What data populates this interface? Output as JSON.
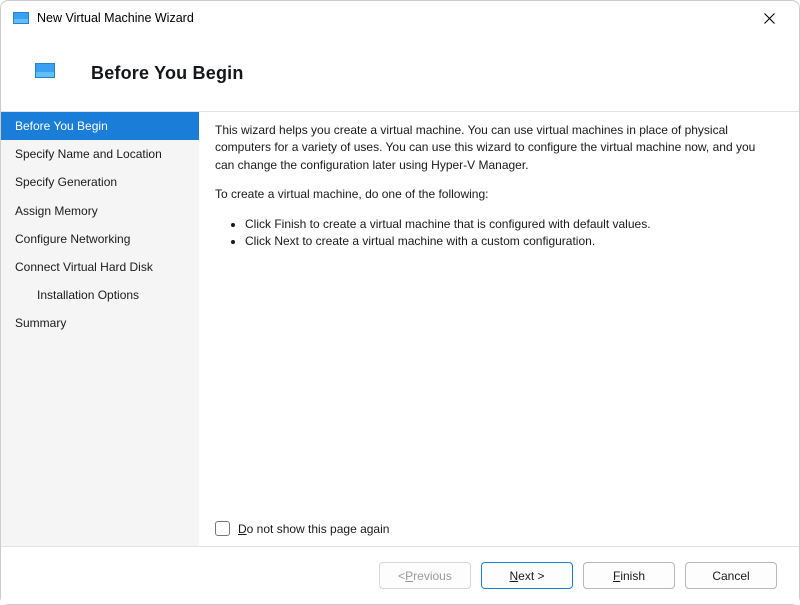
{
  "window": {
    "title": "New Virtual Machine Wizard"
  },
  "banner": {
    "title": "Before You Begin"
  },
  "nav": {
    "items": [
      {
        "label": "Before You Begin",
        "active": true,
        "indent": false
      },
      {
        "label": "Specify Name and Location",
        "active": false,
        "indent": false
      },
      {
        "label": "Specify Generation",
        "active": false,
        "indent": false
      },
      {
        "label": "Assign Memory",
        "active": false,
        "indent": false
      },
      {
        "label": "Configure Networking",
        "active": false,
        "indent": false
      },
      {
        "label": "Connect Virtual Hard Disk",
        "active": false,
        "indent": false
      },
      {
        "label": "Installation Options",
        "active": false,
        "indent": true
      },
      {
        "label": "Summary",
        "active": false,
        "indent": false
      }
    ]
  },
  "content": {
    "para1": "This wizard helps you create a virtual machine. You can use virtual machines in place of physical computers for a variety of uses. You can use this wizard to configure the virtual machine now, and you can change the configuration later using Hyper-V Manager.",
    "para2": "To create a virtual machine, do one of the following:",
    "bullets": [
      "Click Finish to create a virtual machine that is configured with default values.",
      "Click Next to create a virtual machine with a custom configuration."
    ],
    "checkbox_pre": "",
    "checkbox_mn": "D",
    "checkbox_rest": "o not show this page again"
  },
  "footer": {
    "previous_pre": "< ",
    "previous_mn": "P",
    "previous_rest": "revious",
    "next_mn": "N",
    "next_rest": "ext >",
    "finish_mn": "F",
    "finish_rest": "inish",
    "cancel": "Cancel"
  }
}
